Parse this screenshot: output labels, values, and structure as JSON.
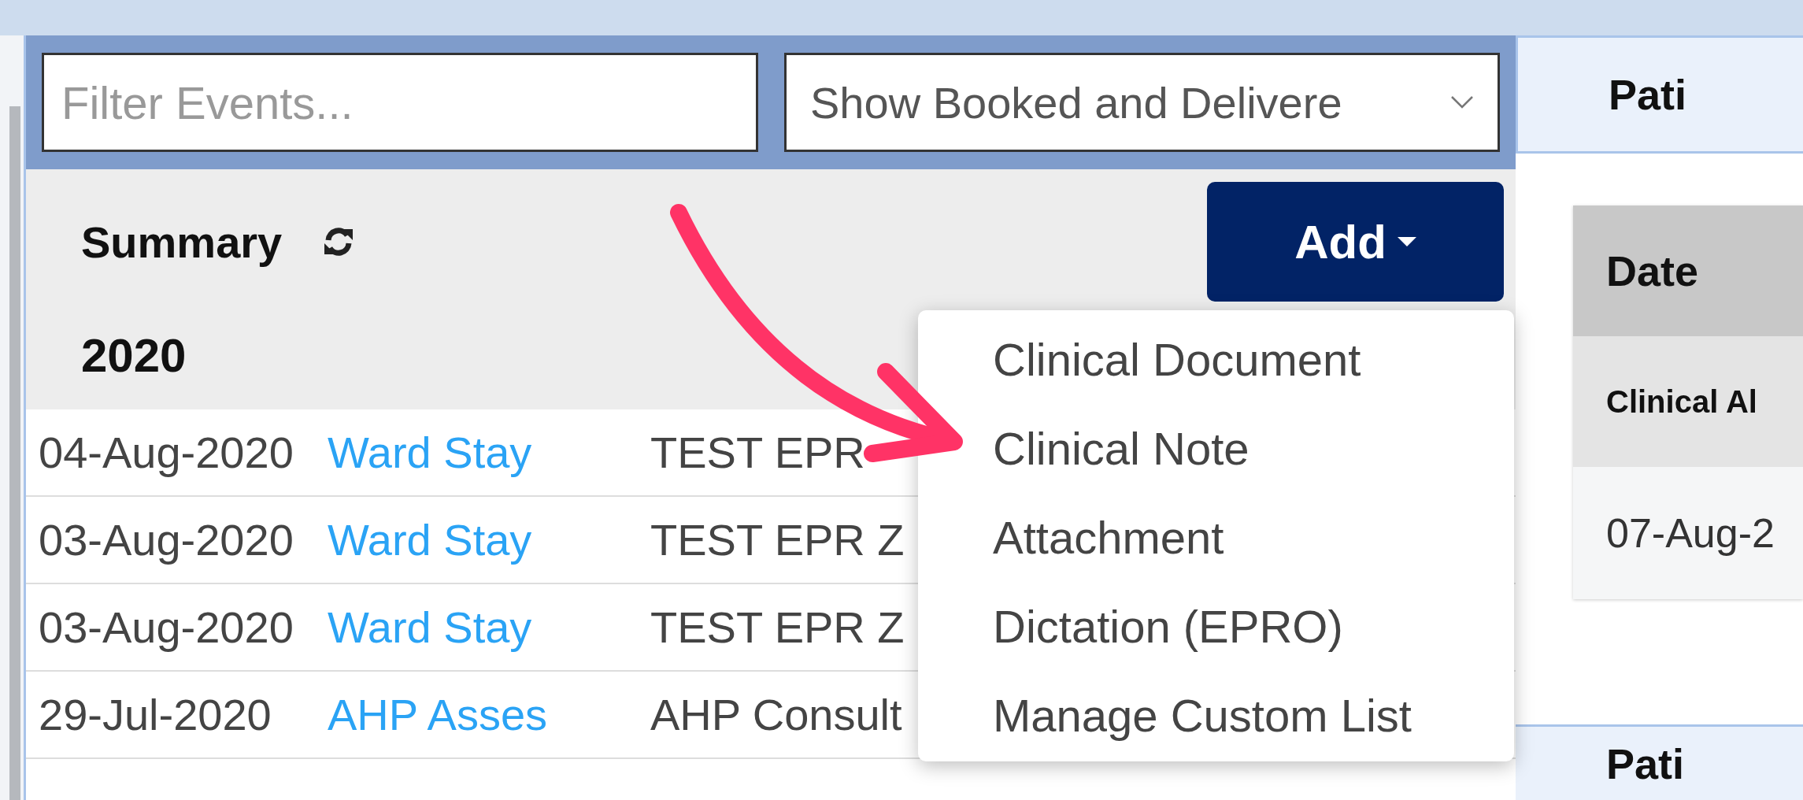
{
  "filter": {
    "placeholder": "Filter Events..."
  },
  "view_select": {
    "value": "Show Booked and Delivere"
  },
  "summary": {
    "title": "Summary"
  },
  "add_button": {
    "label": "Add",
    "expanded": true
  },
  "year": "2020",
  "events": [
    {
      "date": "04-Aug-2020",
      "type": "Ward Stay",
      "description": "TEST EPR"
    },
    {
      "date": "03-Aug-2020",
      "type": "Ward Stay",
      "description": "TEST EPR Z"
    },
    {
      "date": "03-Aug-2020",
      "type": "Ward Stay",
      "description": "TEST EPR Z"
    },
    {
      "date": "29-Jul-2020",
      "type": "AHP Asses",
      "description": "AHP Consult"
    }
  ],
  "add_menu": {
    "items": [
      "Clinical Document",
      "Clinical Note",
      "Attachment",
      "Dictation (EPRO)",
      "Manage Custom List"
    ]
  },
  "right_panel": {
    "header": "Pati",
    "table": {
      "columns": [
        "Date"
      ],
      "section": "Clinical Al",
      "rows": [
        [
          "07-Aug-2"
        ]
      ]
    },
    "footer": "Pati"
  }
}
